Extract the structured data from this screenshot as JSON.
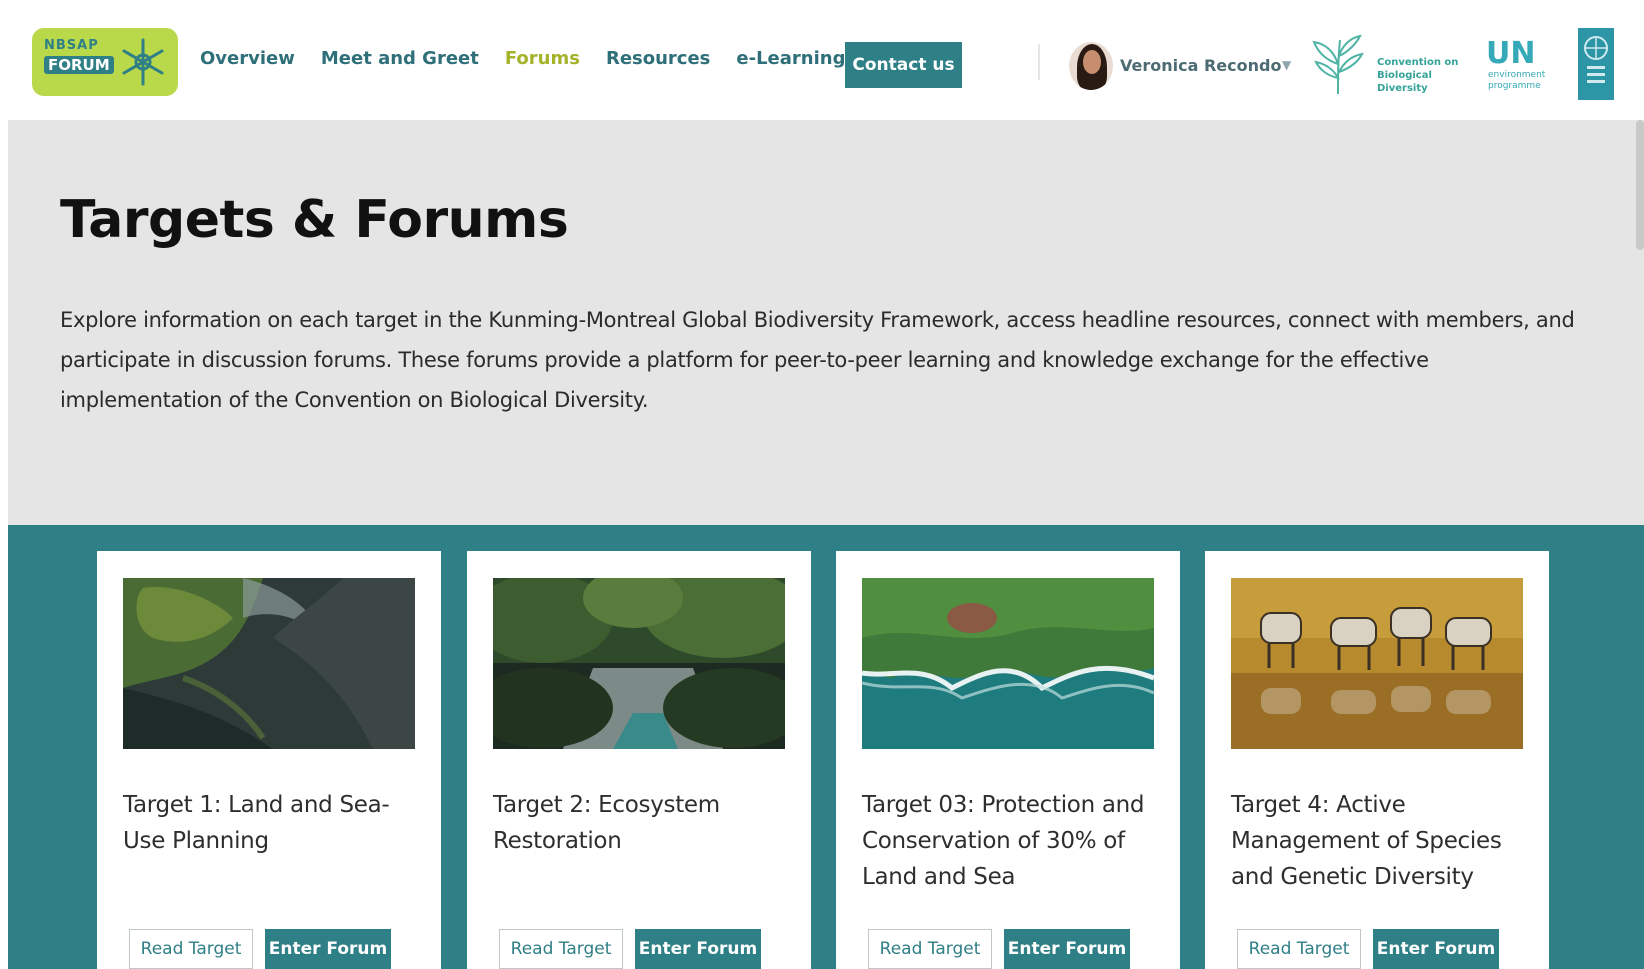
{
  "nav": {
    "logo_line1": "NBSAP",
    "logo_line2": "FORUM",
    "links": [
      {
        "label": "Overview",
        "active": false
      },
      {
        "label": "Meet and Greet",
        "active": false
      },
      {
        "label": "Forums",
        "active": true
      },
      {
        "label": "Resources",
        "active": false
      },
      {
        "label": "e-Learning",
        "active": false
      }
    ],
    "contact_label": "Contact us",
    "user_name": "Veronica Recondo",
    "cbd_text": "Convention on Biological Diversity",
    "un_text": "UN",
    "un_sub": "environment programme"
  },
  "hero": {
    "title": "Targets & Forums",
    "description": "Explore information on each target in the Kunming-Montreal Global Biodiversity Framework, access headline resources, connect with members, and participate in discussion forums. These forums provide a platform for peer-to-peer learning and knowledge exchange for the effective implementation of the Convention on Biological Diversity."
  },
  "cards": [
    {
      "title": "Target 1: Land and Sea-Use Planning",
      "read_label": "Read Target",
      "enter_label": "Enter Forum",
      "image": "coastal-landscape"
    },
    {
      "title": "Target 2: Ecosystem Restoration",
      "read_label": "Read Target",
      "enter_label": "Enter Forum",
      "image": "river-forest"
    },
    {
      "title": "Target 03: Protection and Conservation of 30% of Land and Sea",
      "read_label": "Read Target",
      "enter_label": "Enter Forum",
      "image": "aerial-coast"
    },
    {
      "title": "Target 4: Active Management of Species and Genetic Diversity",
      "read_label": "Read Target",
      "enter_label": "Enter Forum",
      "image": "zebras-waterhole"
    }
  ],
  "colors": {
    "primary": "#2f7f86",
    "accent": "#a5b32a",
    "hero_bg": "#e5e5e5",
    "logo_green": "#b9d94a"
  }
}
